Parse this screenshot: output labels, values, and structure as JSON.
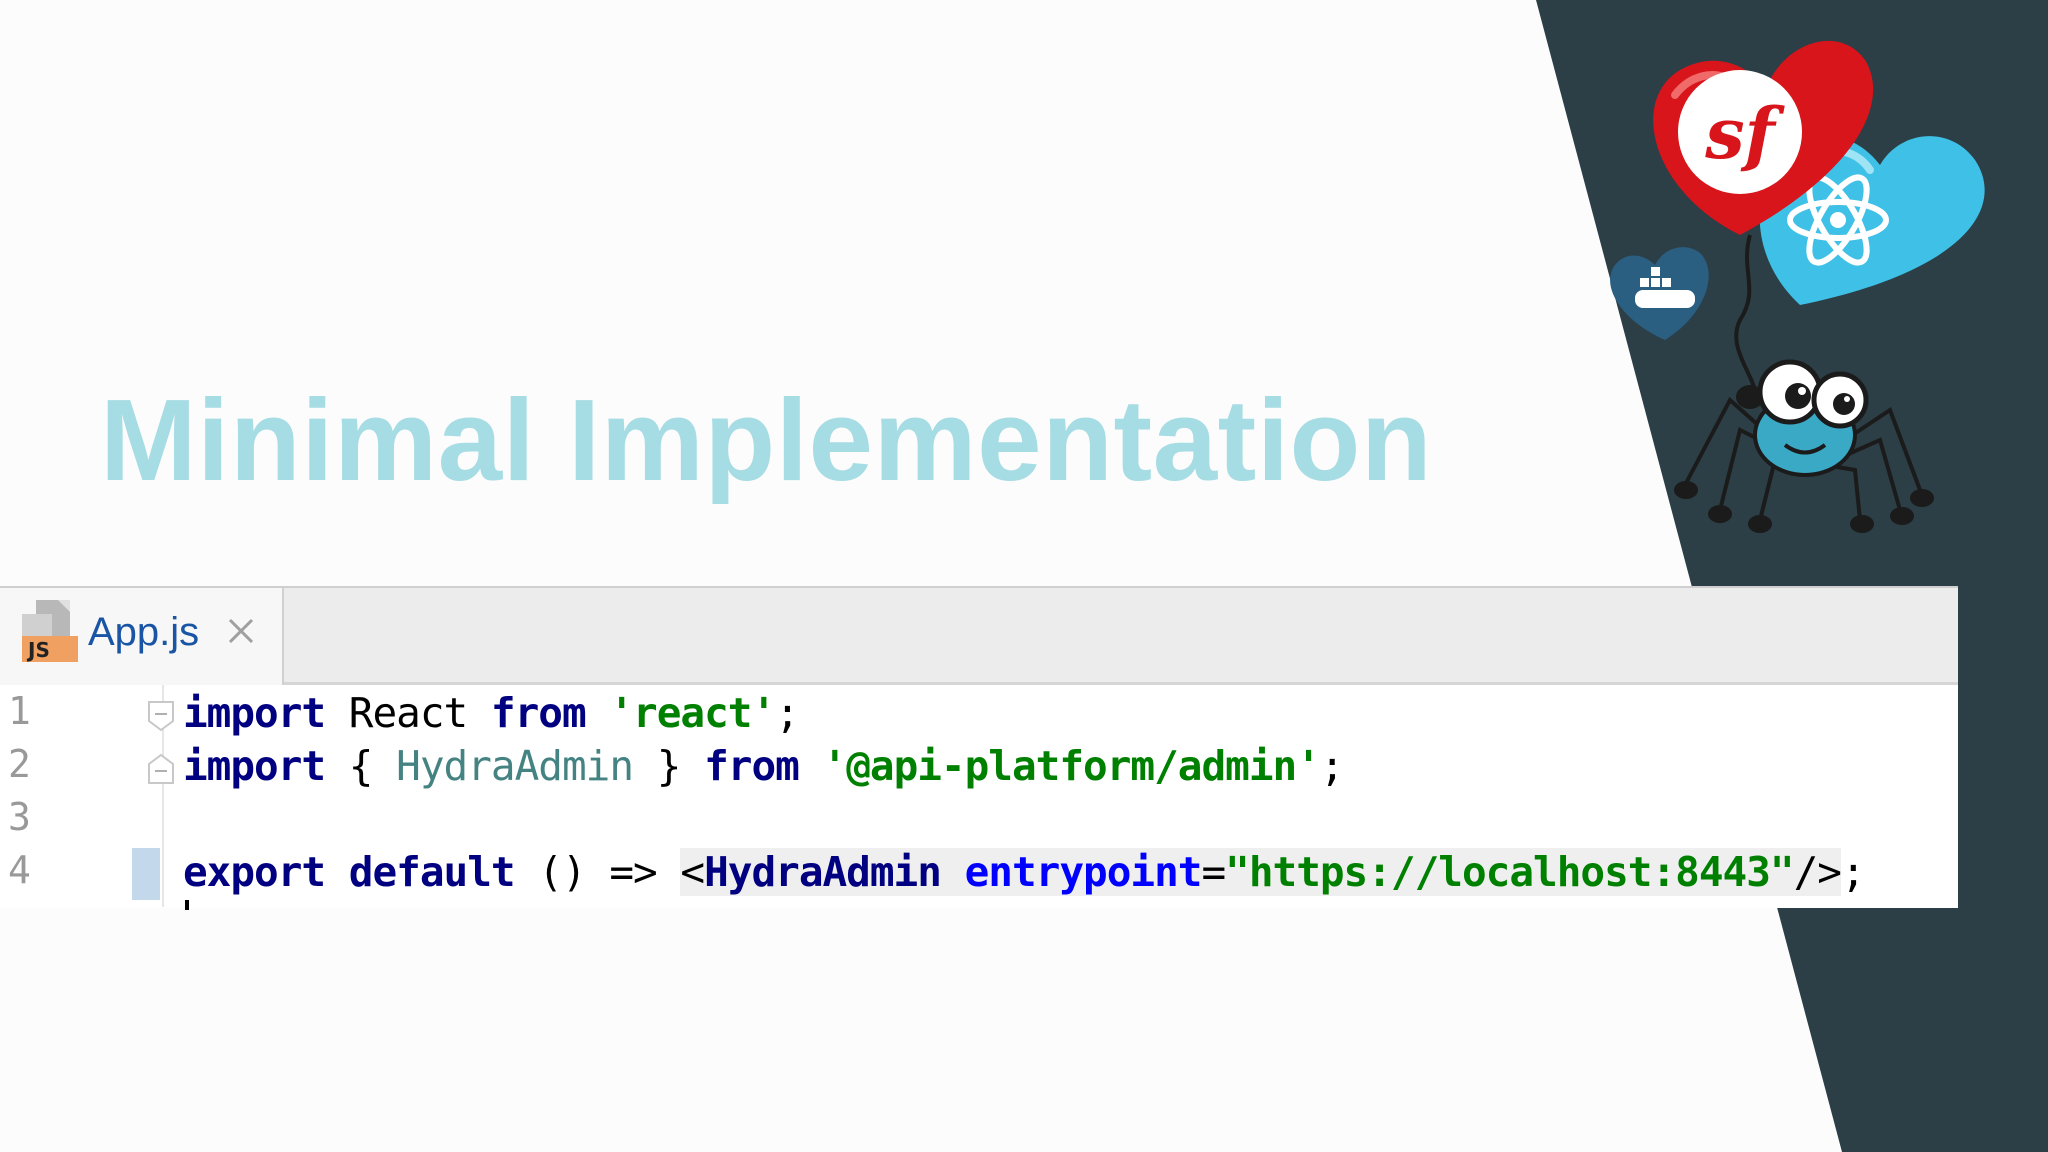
{
  "slide": {
    "title": "Minimal Implementation"
  },
  "editor": {
    "tab": {
      "icon": "js-file-icon",
      "label": "App.js",
      "close_icon": "close-icon"
    },
    "lines": [
      {
        "number": "1",
        "code": "import React from 'react';"
      },
      {
        "number": "2",
        "code": "import { HydraAdmin } from '@api-platform/admin';"
      },
      {
        "number": "3",
        "code": ""
      },
      {
        "number": "4",
        "code": "export default () => <HydraAdmin entrypoint=\"https://localhost:8443\"/>;"
      }
    ],
    "tokens": {
      "l1": {
        "import": "import",
        "react_id": " React ",
        "from": "from",
        "sp": " ",
        "str": "'react'",
        "end": ";"
      },
      "l2": {
        "import": "import",
        "open": " { ",
        "ident": "HydraAdmin",
        "close": " } ",
        "from": "from",
        "sp": " ",
        "str": "'@api-platform/admin'",
        "end": ";"
      },
      "l4": {
        "export": "export",
        "sp1": " ",
        "default": "default",
        "arrow": " () => ",
        "lt": "<",
        "tag": "HydraAdmin",
        "sp2": " ",
        "attr": "entrypoint",
        "eq": "=",
        "val": "\"https://localhost:8443\"",
        "close": "/>",
        "end": ";"
      }
    }
  },
  "mascots": [
    "symfony-heart-balloon-icon",
    "react-heart-balloon-icon",
    "docker-heart-balloon-icon",
    "spider-mascot-icon"
  ],
  "colors": {
    "title": "#a6dce3",
    "panel": "#2c3e46",
    "keyword": "#000080",
    "string": "#008000",
    "attribute": "#0000ff"
  }
}
